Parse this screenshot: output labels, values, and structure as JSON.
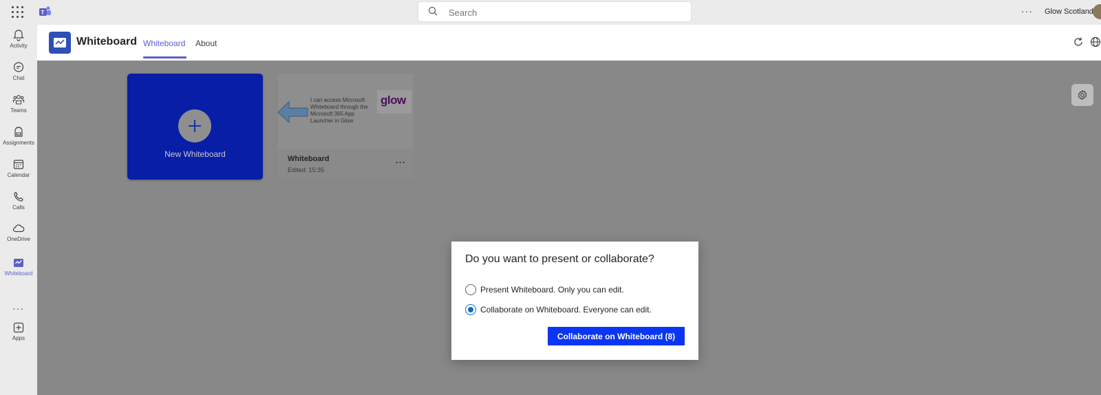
{
  "topbar": {
    "search_placeholder": "Search",
    "more": "···",
    "user_name": "Glow Scotland"
  },
  "rail": {
    "items": [
      {
        "label": "Activity",
        "icon": "bell-icon"
      },
      {
        "label": "Chat",
        "icon": "chat-icon"
      },
      {
        "label": "Teams",
        "icon": "teams-icon"
      },
      {
        "label": "Assignments",
        "icon": "backpack-icon"
      },
      {
        "label": "Calendar",
        "icon": "calendar-icon"
      },
      {
        "label": "Calls",
        "icon": "phone-icon"
      },
      {
        "label": "OneDrive",
        "icon": "cloud-icon"
      },
      {
        "label": "Whiteboard",
        "icon": "whiteboard-icon",
        "active": true
      },
      {
        "label": "Apps",
        "icon": "plus-box-icon"
      }
    ],
    "more": "···"
  },
  "app": {
    "title": "Whiteboard",
    "tabs": [
      {
        "label": "Whiteboard",
        "active": true
      },
      {
        "label": "About",
        "active": false
      }
    ]
  },
  "cards": {
    "new_label": "New Whiteboard",
    "board": {
      "thumbnail_text": "I can access Microsoft Whiteboard through the Microsoft 365 App Launcher in Glow",
      "thumbnail_logo": "glow",
      "title": "Whiteboard",
      "edited": "Edited: 15:35",
      "more": "···"
    }
  },
  "dialog": {
    "title": "Do you want to present or collaborate?",
    "options": [
      {
        "label": "Present Whiteboard. Only you can edit.",
        "checked": false
      },
      {
        "label": "Collaborate on Whiteboard. Everyone can edit.",
        "checked": true
      }
    ],
    "button_label": "Collaborate on Whiteboard (8)"
  },
  "colors": {
    "accent": "#5b5fc7",
    "primary_button": "#0a35f2",
    "new_card": "#091ea6",
    "overlay": "#888888"
  }
}
